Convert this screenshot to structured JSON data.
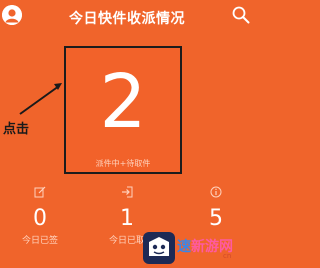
{
  "header": {
    "title": "今日快件收派情况",
    "avatar_icon": "user-avatar-icon",
    "search_icon": "search-icon"
  },
  "main_box": {
    "value": "2",
    "label": "派件中+待取件"
  },
  "annotation": {
    "text": "点击"
  },
  "stats": [
    {
      "icon": "edit-icon",
      "value": "0",
      "label": "今日已签"
    },
    {
      "icon": "sign-in-icon",
      "value": "1",
      "label": "今日已取"
    },
    {
      "icon": "info-icon",
      "value": "5",
      "label": ""
    }
  ],
  "watermark": {
    "text_blue": "速",
    "text_pink": "新游网",
    "url": "cn"
  },
  "colors": {
    "background": "#f0642b",
    "text": "#ffffff",
    "muted": "#ffd2bd",
    "annotation": "#1a1a1a"
  }
}
